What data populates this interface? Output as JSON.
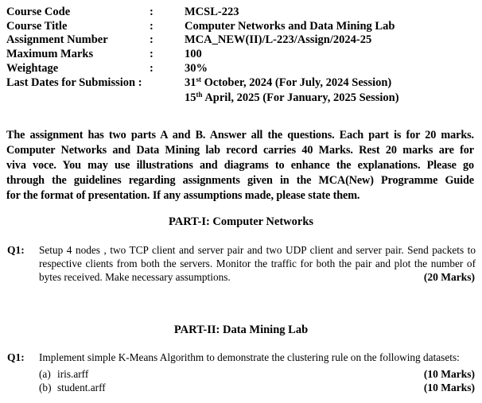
{
  "header": {
    "rows": [
      {
        "label": "Course Code",
        "colon": ":",
        "value": "MCSL-223"
      },
      {
        "label": "Course Title",
        "colon": ":",
        "value": "Computer Networks and Data Mining Lab"
      },
      {
        "label": "Assignment Number",
        "colon": ":",
        "value": "MCA_NEW(II)/L-223/Assign/2024-25"
      },
      {
        "label": "Maximum Marks",
        "colon": ":",
        "value": "100"
      },
      {
        "label": "Weightage",
        "colon": ":",
        "value": "30%"
      },
      {
        "label": "Last Dates for Submission :",
        "colon": "",
        "value": ""
      }
    ],
    "submission_dates": [
      {
        "day": "31",
        "suffix": "st",
        "rest": " October, 2024 (For July, 2024 Session)"
      },
      {
        "day": "15",
        "suffix": "th",
        "rest": " April, 2025 (For January, 2025 Session)"
      }
    ]
  },
  "intro": {
    "lines": [
      "The assignment has two parts A and B. Answer all the questions. Each part is for 20 marks.",
      "Computer Networks and Data Mining lab record carries 40 Marks. Rest 20 marks are for",
      "viva voce.  You may use illustrations and diagrams to enhance the explanations.  Please go",
      "through the guidelines regarding assignments given in the MCA(New) Programme Guide",
      "for the format of presentation.  If any assumptions made, please state them."
    ]
  },
  "part1": {
    "heading": "PART-I: Computer Networks",
    "question": {
      "label": "Q1:",
      "lines": [
        "Setup 4 nodes , two TCP client and server pair and two UDP client and server pair. Send packets to",
        "respective clients from both the servers. Monitor the traffic for both the pair and plot the number of",
        "bytes received. Make necessary assumptions."
      ],
      "marks": "(20 Marks)"
    }
  },
  "part2": {
    "heading": "PART-II: Data Mining Lab",
    "question": {
      "label": "Q1:",
      "text": "Implement simple K-Means Algorithm to demonstrate the clustering rule on the following datasets:",
      "subitems": [
        {
          "tag": "(a)",
          "text": "iris.arff",
          "marks": "(10 Marks)"
        },
        {
          "tag": "(b)",
          "text": "student.arff",
          "marks": "(10 Marks)"
        }
      ]
    }
  }
}
